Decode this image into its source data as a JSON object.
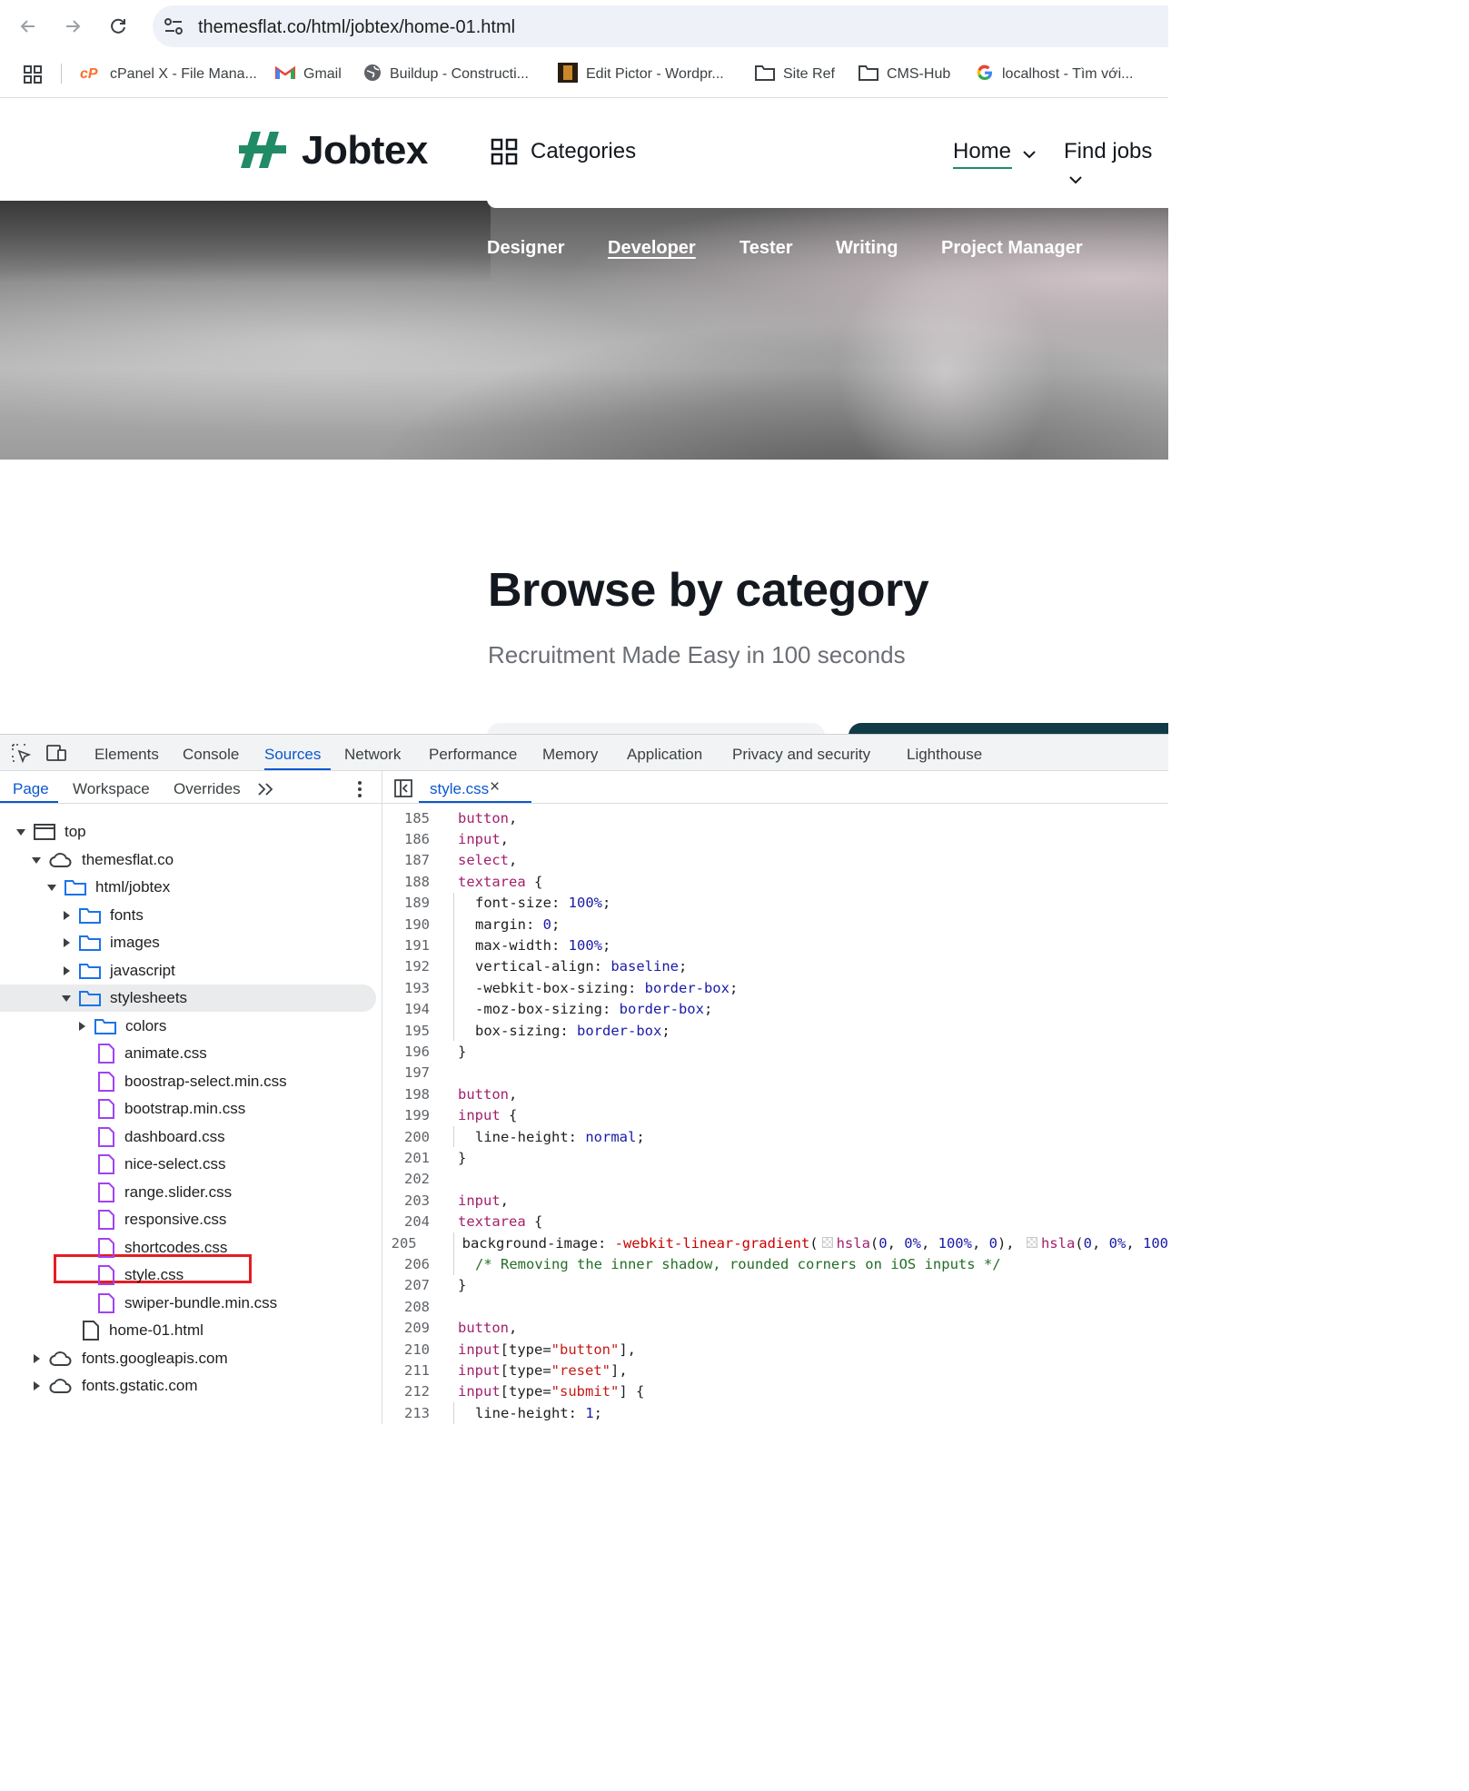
{
  "browser": {
    "url": "themesflat.co/html/jobtex/home-01.html",
    "bookmarks": [
      {
        "label": "cPanel X - File Mana...",
        "icon": "cpanel-icon"
      },
      {
        "label": "Gmail",
        "icon": "gmail-icon"
      },
      {
        "label": "Buildup - Constructi...",
        "icon": "globe-icon"
      },
      {
        "label": "Edit Pictor - Wordpr...",
        "icon": "pictor-icon"
      },
      {
        "label": "Site Ref",
        "icon": "folder-icon"
      },
      {
        "label": "CMS-Hub",
        "icon": "folder-icon"
      },
      {
        "label": "localhost - Tìm với...",
        "icon": "google-icon"
      }
    ]
  },
  "site": {
    "logo": "Jobtex",
    "categories_label": "Categories",
    "nav": {
      "home": "Home",
      "find_jobs": "Find jobs"
    },
    "hero_tabs": [
      "Designer",
      "Developer",
      "Tester",
      "Writing",
      "Project Manager"
    ],
    "active_hero_tab": "Developer",
    "section_title": "Browse by category",
    "section_subtitle": "Recruitment Made Easy in 100 seconds",
    "brand_color": "#218b66"
  },
  "devtools": {
    "tabs": [
      "Elements",
      "Console",
      "Sources",
      "Network",
      "Performance",
      "Memory",
      "Application",
      "Privacy and security",
      "Lighthouse"
    ],
    "active_tab": "Sources",
    "sub_tabs": [
      "Page",
      "Workspace",
      "Overrides"
    ],
    "active_sub_tab": "Page",
    "open_file": "style.css",
    "tree": [
      {
        "label": "top",
        "type": "frame"
      },
      {
        "label": "themesflat.co",
        "type": "cloud"
      },
      {
        "label": "html/jobtex",
        "type": "folder"
      },
      {
        "label": "fonts",
        "type": "folder"
      },
      {
        "label": "images",
        "type": "folder"
      },
      {
        "label": "javascript",
        "type": "folder"
      },
      {
        "label": "stylesheets",
        "type": "folder"
      },
      {
        "label": "colors",
        "type": "folder"
      },
      {
        "label": "animate.css",
        "type": "file"
      },
      {
        "label": "boostrap-select.min.css",
        "type": "file"
      },
      {
        "label": "bootstrap.min.css",
        "type": "file"
      },
      {
        "label": "dashboard.css",
        "type": "file"
      },
      {
        "label": "nice-select.css",
        "type": "file"
      },
      {
        "label": "range.slider.css",
        "type": "file"
      },
      {
        "label": "responsive.css",
        "type": "file"
      },
      {
        "label": "shortcodes.css",
        "type": "file"
      },
      {
        "label": "style.css",
        "type": "file"
      },
      {
        "label": "swiper-bundle.min.css",
        "type": "file"
      },
      {
        "label": "home-01.html",
        "type": "doc"
      },
      {
        "label": "fonts.googleapis.com",
        "type": "cloud"
      },
      {
        "label": "fonts.gstatic.com",
        "type": "cloud"
      }
    ],
    "selected_folder": "stylesheets",
    "highlighted_file": "style.css",
    "code_lines": [
      {
        "n": "185",
        "t": "button,"
      },
      {
        "n": "186",
        "t": "input,"
      },
      {
        "n": "187",
        "t": "select,"
      },
      {
        "n": "188",
        "t": "textarea {"
      },
      {
        "n": "189",
        "t": "font-size: 100%;"
      },
      {
        "n": "190",
        "t": "margin: 0;"
      },
      {
        "n": "191",
        "t": "max-width: 100%;"
      },
      {
        "n": "192",
        "t": "vertical-align: baseline;"
      },
      {
        "n": "193",
        "t": "-webkit-box-sizing: border-box;"
      },
      {
        "n": "194",
        "t": "-moz-box-sizing: border-box;"
      },
      {
        "n": "195",
        "t": "box-sizing: border-box;"
      },
      {
        "n": "196",
        "t": "}"
      },
      {
        "n": "197",
        "t": ""
      },
      {
        "n": "198",
        "t": "button,"
      },
      {
        "n": "199",
        "t": "input {"
      },
      {
        "n": "200",
        "t": "line-height: normal;"
      },
      {
        "n": "201",
        "t": "}"
      },
      {
        "n": "202",
        "t": ""
      },
      {
        "n": "203",
        "t": "input,"
      },
      {
        "n": "204",
        "t": "textarea {"
      },
      {
        "n": "205",
        "t": "background-image: -webkit-linear-gradient(hsla(0, 0%, 100%, 0), hsla(0, 0%, 100"
      },
      {
        "n": "206",
        "t": "/* Removing the inner shadow, rounded corners on iOS inputs */"
      },
      {
        "n": "207",
        "t": "}"
      },
      {
        "n": "208",
        "t": ""
      },
      {
        "n": "209",
        "t": "button,"
      },
      {
        "n": "210",
        "t": "input[type=\"button\"],"
      },
      {
        "n": "211",
        "t": "input[type=\"reset\"],"
      },
      {
        "n": "212",
        "t": "input[type=\"submit\"] {"
      },
      {
        "n": "213",
        "t": "line-height: 1;"
      }
    ]
  }
}
